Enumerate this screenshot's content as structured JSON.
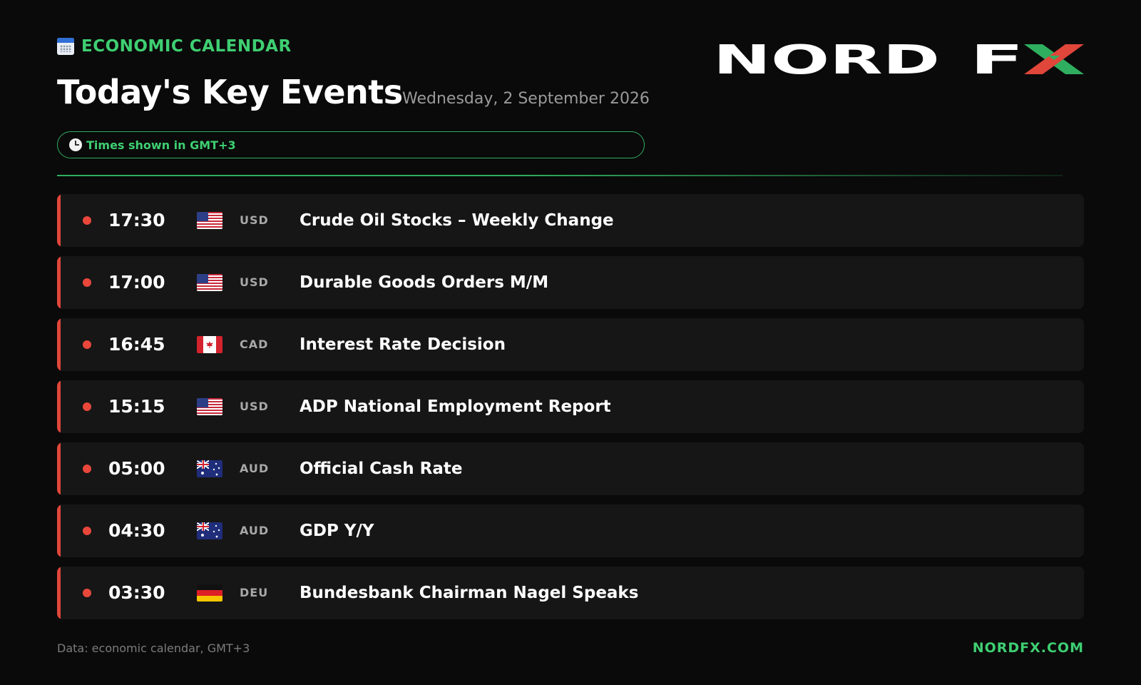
{
  "header": {
    "kicker": "ECONOMIC CALENDAR",
    "kicker_icon": "calendar-icon",
    "title": "Today's Key Events",
    "date": "Wednesday, 2 September 2026",
    "timezone_note": "Times shown in GMT+3",
    "timezone_icon": "clock-icon"
  },
  "logo": {
    "text": "NORD FX",
    "accent_colors": [
      "#e0463a",
      "#2fae5f"
    ]
  },
  "events": [
    {
      "time": "17:30",
      "currency": "USD",
      "flag": "us-flag-icon",
      "name": "Crude Oil Stocks – Weekly Change"
    },
    {
      "time": "17:00",
      "currency": "USD",
      "flag": "us-flag-icon",
      "name": "Durable Goods Orders M/M"
    },
    {
      "time": "16:45",
      "currency": "CAD",
      "flag": "canada-flag-icon",
      "name": "Interest Rate Decision"
    },
    {
      "time": "15:15",
      "currency": "USD",
      "flag": "us-flag-icon",
      "name": "ADP National Employment Report"
    },
    {
      "time": "05:00",
      "currency": "AUD",
      "flag": "australia-flag-icon",
      "name": "Official Cash Rate"
    },
    {
      "time": "04:30",
      "currency": "AUD",
      "flag": "australia-flag-icon",
      "name": "GDP Y/Y"
    },
    {
      "time": "03:30",
      "currency": "DEU",
      "flag": "germany-flag-icon",
      "name": "Bundesbank Chairman Nagel Speaks"
    }
  ],
  "footer": {
    "note": "Data: economic calendar, GMT+3",
    "brand": "NORDFX.COM"
  },
  "colors": {
    "background": "#0a0a0a",
    "accent_green": "#3ecf72",
    "impact_red": "#e0463a",
    "row_background": "#161616"
  }
}
